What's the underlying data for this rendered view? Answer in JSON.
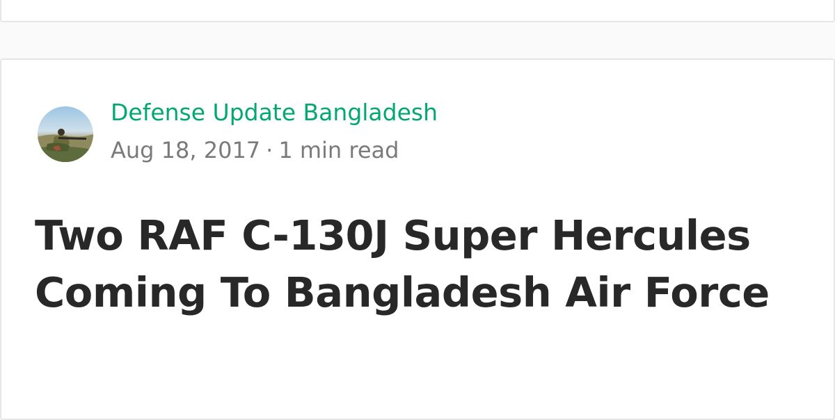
{
  "post": {
    "author": "Defense Update Bangladesh",
    "date": "Aug 18, 2017",
    "separator": "·",
    "read_time": "1 min read",
    "title": "Two RAF C-130J Super Hercules Coming To Bangladesh Air Force"
  },
  "colors": {
    "author_link": "#02a86f",
    "meta_text": "#7a7a7a",
    "title_text": "#282828"
  },
  "icons": {
    "avatar": "author-avatar-soldier-photo"
  }
}
